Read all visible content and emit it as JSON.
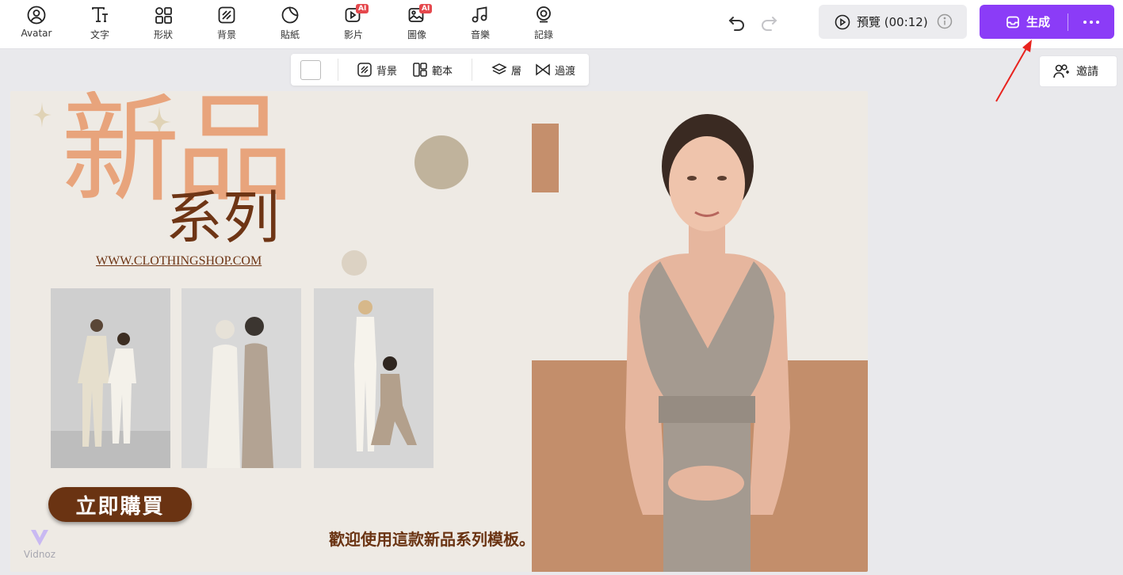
{
  "toolbar": {
    "tools": [
      {
        "label": "Avatar",
        "icon": "avatar-icon"
      },
      {
        "label": "文字",
        "icon": "text-icon"
      },
      {
        "label": "形狀",
        "icon": "shapes-icon"
      },
      {
        "label": "背景",
        "icon": "background-icon"
      },
      {
        "label": "貼紙",
        "icon": "sticker-icon"
      },
      {
        "label": "影片",
        "icon": "video-icon",
        "badge": "AI"
      },
      {
        "label": "圖像",
        "icon": "image-icon",
        "badge": "AI"
      },
      {
        "label": "音樂",
        "icon": "music-icon"
      },
      {
        "label": "記錄",
        "icon": "record-icon"
      }
    ],
    "preview_label": "預覽 (00:12)",
    "generate_label": "生成",
    "invite_label": "邀請"
  },
  "subbar": {
    "background_label": "背景",
    "template_label": "範本",
    "layer_label": "層",
    "transition_label": "過渡"
  },
  "canvas": {
    "title_big": "新品",
    "title_sub": "系列",
    "url": "WWW.CLOTHINGSHOP.COM",
    "buy_label": "立即購買",
    "welcome_text": "歡迎使用這款新品系列模板。",
    "watermark": "Vidnoz"
  },
  "colors": {
    "accent_purple": "#8b3cf7",
    "peach": "#e8a47c",
    "brown": "#6a3312",
    "tan": "#c38e6b",
    "canvas_bg": "#eeeae4"
  }
}
